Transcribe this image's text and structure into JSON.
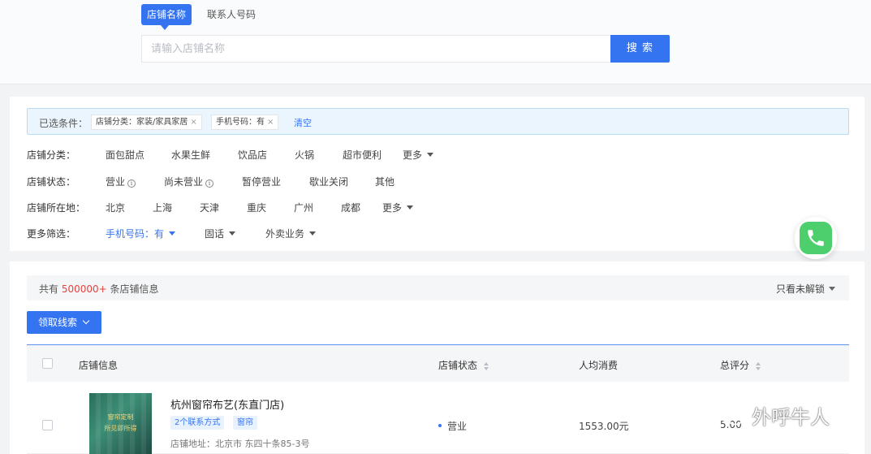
{
  "search": {
    "tabs": [
      "店铺名称",
      "联系人号码"
    ],
    "placeholder": "请输入店铺名称",
    "button": "搜 索"
  },
  "filters": {
    "selected_label": "已选条件：",
    "chips": [
      "店铺分类：家装/家具家居",
      "手机号码：有"
    ],
    "clear": "清空",
    "rows": [
      {
        "label": "店铺分类：",
        "items": [
          "面包甜点",
          "水果生鲜",
          "饮品店",
          "火锅",
          "超市便利",
          "更多"
        ]
      },
      {
        "label": "店铺状态：",
        "items": [
          "营业",
          "尚未营业",
          "暂停营业",
          "歇业关闭",
          "其他"
        ]
      },
      {
        "label": "店铺所在地：",
        "items": [
          "北京",
          "上海",
          "天津",
          "重庆",
          "广州",
          "成都",
          "更多"
        ]
      },
      {
        "label": "更多筛选：",
        "items": [
          "手机号码：有",
          "固话",
          "外卖业务"
        ]
      }
    ]
  },
  "results": {
    "count_prefix": "共有",
    "count_value": "500000+",
    "count_suffix": "条店铺信息",
    "unlock_filter": "只看未解锁",
    "claim_button": "领取线索",
    "columns": [
      "店铺信息",
      "店铺状态",
      "人均消费",
      "总评分"
    ],
    "rows": [
      {
        "name": "杭州窗帘布艺(东直门店)",
        "tags": [
          "2个联系方式",
          "窗帘"
        ],
        "address": "店铺地址：北京市 东四十条85-3号",
        "thumb_text": [
          "窗帘定制",
          "所见即所得"
        ],
        "status": "营业",
        "price": "1553.00元",
        "score": "5.00"
      }
    ]
  },
  "watermark": "外呼牛人",
  "colors": {
    "accent": "#3574f0",
    "count_highlight": "#e8423f",
    "phone_green": "#4ccf6c"
  }
}
